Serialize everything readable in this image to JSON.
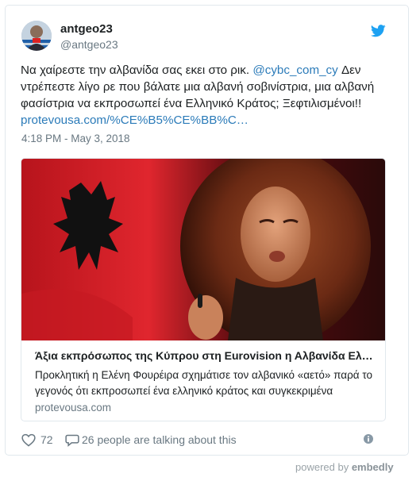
{
  "tweet": {
    "display_name": "antgeo23",
    "handle": "@antgeo23",
    "text_before_mention": "Να χαίρεστε την αλβανίδα σας εκει στο ρικ. ",
    "mention": "@cybc_com_cy",
    "text_after_mention": "  Δεν ντρέπεστε λίγο ρε που βάλατε μια αλβανή σοβινίστρια, μια αλβανή φασίστρια να εκπροσωπεί ένα Ελληνικό Κράτος; Ξεφτιλισμένοι!! ",
    "link": "protevousa.com/%CE%B5%CE%BB%C…",
    "timestamp": "4:18 PM - May 3, 2018"
  },
  "card": {
    "title": "Άξια εκπρόσωπος της Κύπρου στη Eurovision η Αλβανίδα Ελ…",
    "description": "Προκλητική η Ελένη Φουρέιρα σχημάτισε τον αλβανικό «αετό» παρά το γεγονός ότι εκπροσωπεί ένα ελληνικό κράτος και συγκεκριμένα",
    "domain": "protevousa.com"
  },
  "footer": {
    "likes": "72",
    "talking": "26 people are talking about this"
  },
  "powered_by": {
    "prefix": "powered by ",
    "brand": "embedly"
  },
  "colors": {
    "link": "#2b7bb9",
    "twitter_blue": "#1da1f2",
    "muted": "#697882",
    "flag_red": "#d8242c"
  },
  "icons": [
    "twitter-bird-icon",
    "heart-icon",
    "reply-icon",
    "info-icon"
  ]
}
